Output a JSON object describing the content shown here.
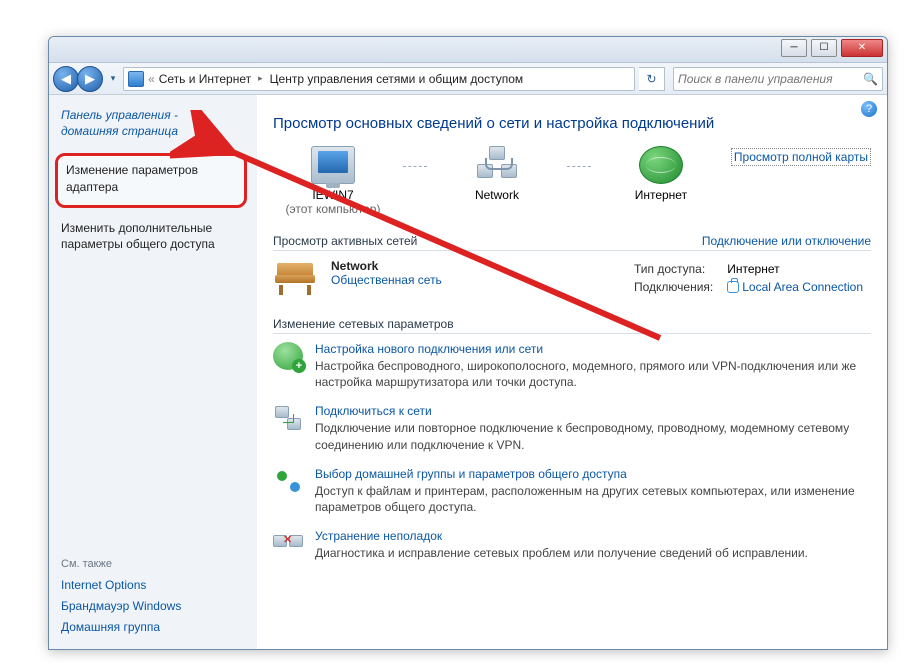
{
  "titlebar": {
    "min": "─",
    "max": "☐",
    "close": "✕"
  },
  "nav": {
    "back": "◀",
    "forward": "▶",
    "menu": "▾",
    "sep": "«",
    "crumb1": "Сеть и Интернет",
    "crumb2": "Центр управления сетями и общим доступом",
    "tri": "▸",
    "refresh": "↻",
    "search_placeholder": "Поиск в панели управления",
    "mag": "🔍"
  },
  "sidebar": {
    "cp_home_l1": "Панель управления -",
    "cp_home_l2": "домашняя страница",
    "task_adapter_l1": "Изменение параметров",
    "task_adapter_l2": "адаптера",
    "task_sharing_l1": "Изменить дополнительные",
    "task_sharing_l2": "параметры общего доступа",
    "seealso_head": "См. также",
    "seealso": {
      "io": "Internet Options",
      "fw": "Брандмауэр Windows",
      "hg": "Домашняя группа"
    }
  },
  "main": {
    "help": "?",
    "heading": "Просмотр основных сведений о сети и настройка подключений",
    "map": {
      "node1_name": "IEWIN7",
      "node1_sub": "(этот компьютер)",
      "node2_name": "Network",
      "node3_name": "Интернет",
      "full_map": "Просмотр полной карты"
    },
    "active": {
      "head": "Просмотр активных сетей",
      "toggle": "Подключение или отключение",
      "net_name": "Network",
      "net_type": "Общественная сеть",
      "row1_lbl": "Тип доступа:",
      "row1_val": "Интернет",
      "row2_lbl": "Подключения:",
      "row2_val": "Local Area Connection"
    },
    "settings": {
      "head": "Изменение сетевых параметров",
      "t1_link": "Настройка нового подключения или сети",
      "t1_desc": "Настройка беспроводного, широкополосного, модемного, прямого или VPN-подключения или же настройка маршрутизатора или точки доступа.",
      "t2_link": "Подключиться к сети",
      "t2_desc": "Подключение или повторное подключение к беспроводному, проводному, модемному сетевому соединению или подключение к VPN.",
      "t3_link": "Выбор домашней группы и параметров общего доступа",
      "t3_desc": "Доступ к файлам и принтерам, расположенным на других сетевых компьютерах, или изменение параметров общего доступа.",
      "t4_link": "Устранение неполадок",
      "t4_desc": "Диагностика и исправление сетевых проблем или получение сведений об исправлении."
    }
  }
}
